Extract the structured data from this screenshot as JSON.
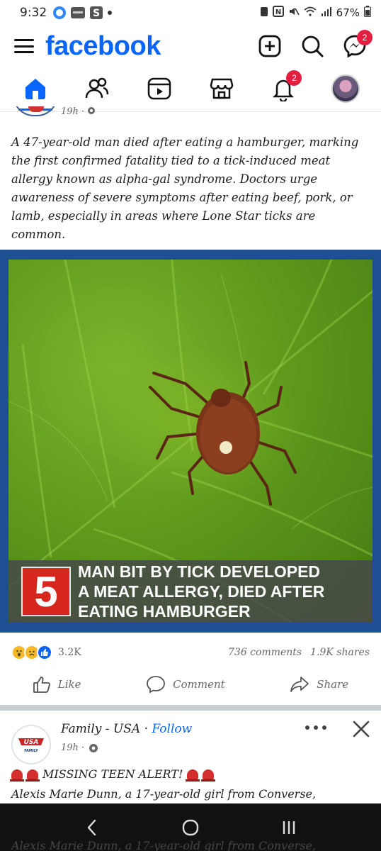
{
  "status_bar": {
    "time": "9:32",
    "battery": "67%",
    "notification_icons": [
      "facebook-messenger-icon",
      "app-icon",
      "s-icon",
      "dot-icon"
    ],
    "system_icons": [
      "battery-saver-icon",
      "nfc-icon",
      "mute-icon",
      "wifi-icon",
      "signal-icon",
      "battery-icon"
    ]
  },
  "header": {
    "logo": "facebook",
    "messenger_badge": "2",
    "brand_color": "#0866ff"
  },
  "nav": {
    "notifications_badge": "2",
    "tabs": [
      "home-icon",
      "friends-icon",
      "video-icon",
      "marketplace-icon",
      "notifications-icon",
      "profile-avatar"
    ]
  },
  "post1": {
    "time": "19h ·",
    "text": "A 47-year-old man died after eating a hamburger, marking the first confirmed fatality tied to a tick-induced meat allergy known as alpha-gal syndrome. Doctors urge awareness of severe symptoms after eating beef, pork, or lamb, especially in areas where Lone Star ticks are common.",
    "image": {
      "channel_number": "5",
      "headline_lines": [
        "MAN BIT BY TICK DEVELOPED",
        "A MEAT ALLERGY, DIED AFTER",
        "EATING HAMBURGER"
      ]
    },
    "reaction_count": "3.2K",
    "comments": "736 comments",
    "shares": "1.9K shares",
    "actions": {
      "like": "Like",
      "comment": "Comment",
      "share": "Share"
    }
  },
  "post2": {
    "author": "Family - USA",
    "separator": " · ",
    "follow": "Follow",
    "time": "19h ·",
    "avatar_text_top": "USA",
    "avatar_text_bottom": "FAMILY",
    "line1": "MISSING TEEN ALERT!",
    "line2": "Alexis Marie Dunn, a 17-year-old girl from Converse,",
    "ghost_line": "Alexis Marie Dunn, a 17-year-old girl from Converse,"
  }
}
